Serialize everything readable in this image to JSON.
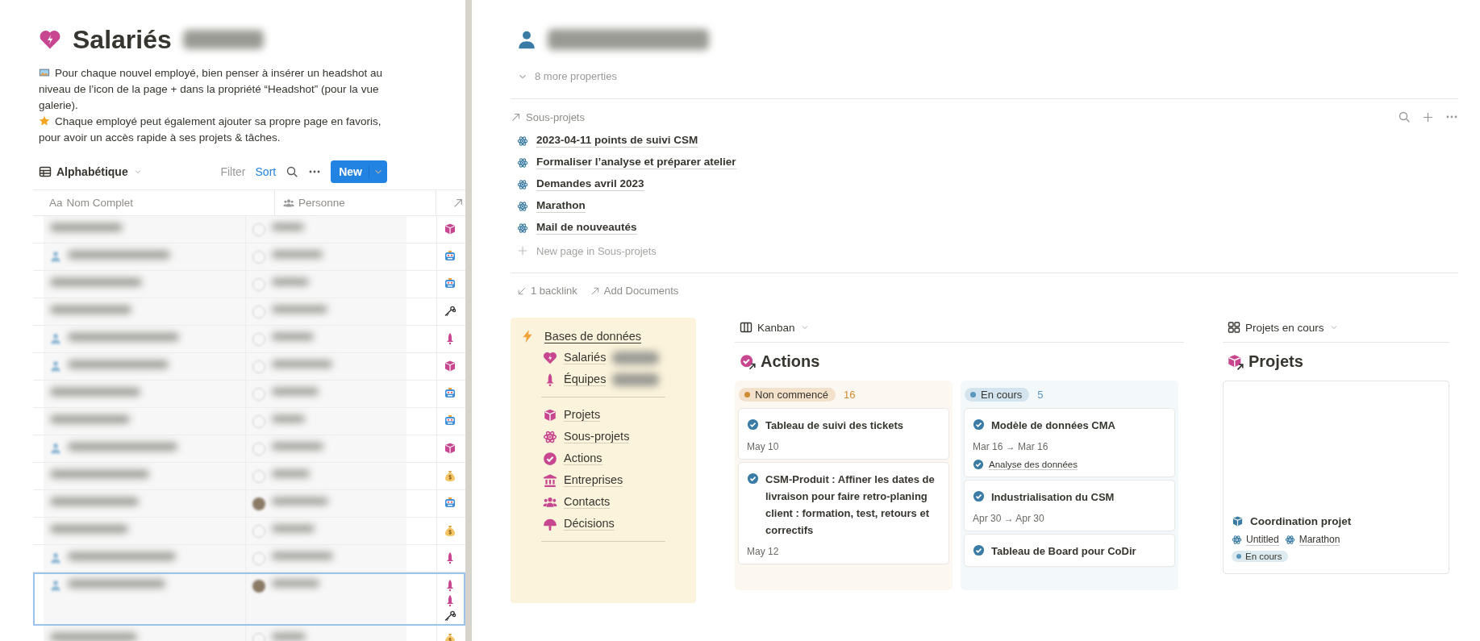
{
  "left_page": {
    "title": "Salariés",
    "description": [
      "Pour chaque nouvel employé, bien penser à insérer un headshot au niveau de l’icon de la page + dans la propriété “Headshot” (pour la vue galerie).",
      "Chaque employé peut également ajouter sa propre page en favoris, pour avoir un accès rapide à ses projets & tâches."
    ],
    "toolbar": {
      "view": "Alphabétique",
      "filter": "Filter",
      "sort": "Sort",
      "new_button": "New"
    },
    "columns": [
      {
        "icon_text": "Aa",
        "label": "Nom Complet"
      },
      {
        "label": "Personne"
      },
      {}
    ],
    "rows": [
      {
        "selected": false
      },
      {
        "selected": false
      },
      {
        "selected": false
      },
      {
        "selected": false
      },
      {
        "selected": false
      },
      {
        "selected": false
      },
      {
        "selected": false
      },
      {
        "selected": false
      },
      {
        "selected": false
      },
      {
        "selected": false
      },
      {
        "selected": false
      },
      {
        "selected": false
      },
      {
        "selected": false
      },
      {
        "selected": true
      },
      {
        "selected": false
      }
    ]
  },
  "right_page": {
    "more_properties": "8 more properties",
    "relation": {
      "label": "Sous-projets",
      "items": [
        "2023-04-11 points de suivi CSM",
        "Formaliser l’analyse et préparer atelier",
        "Demandes avril 2023",
        "Marathon",
        "Mail de nouveautés"
      ],
      "new_page": "New page in Sous-projets"
    },
    "backlinks": "1 backlink",
    "add_documents": "Add Documents",
    "callout": {
      "heading": "Bases de données",
      "items": [
        {
          "kind": "link",
          "label": "Salariés"
        },
        {
          "kind": "link",
          "label": "Équipes"
        },
        {
          "kind": "divider"
        },
        {
          "kind": "link",
          "label": "Projets"
        },
        {
          "kind": "link",
          "label": "Sous-projets"
        },
        {
          "kind": "link",
          "label": "Actions"
        },
        {
          "kind": "link",
          "label": "Entreprises"
        },
        {
          "kind": "link",
          "label": "Contacts"
        },
        {
          "kind": "link",
          "label": "Décisions"
        },
        {
          "kind": "divider"
        }
      ]
    },
    "kanban": {
      "view": "Kanban",
      "title": "Actions",
      "groups": [
        {
          "label": "Non commencé",
          "count": "16",
          "color": "#d08c35",
          "cards": [
            {
              "title": "Tableau de suivi des tickets",
              "date": "May 10"
            },
            {
              "title": "CSM-Produit : Affiner les dates de livraison pour faire retro-planing  client : formation, test, retours et correctifs",
              "date": "May 12"
            }
          ]
        },
        {
          "label": "En cours",
          "count": "5",
          "color": "#5b97bd",
          "cards": [
            {
              "title": "Modèle de données CMA",
              "date": "Mar 16 → Mar 16",
              "sub_project": "Analyse des données"
            },
            {
              "title": "Industrialisation du CSM",
              "date": "Apr 30 → Apr 30"
            },
            {
              "title": "Tableau de Board pour CoDir"
            }
          ]
        }
      ]
    },
    "gallery": {
      "view": "Projets en cours",
      "title": "Projets",
      "cards": [
        {
          "title": "Coordination projet",
          "relations": [
            "Untitled",
            "Marathon"
          ],
          "status": "En cours"
        }
      ]
    }
  }
}
